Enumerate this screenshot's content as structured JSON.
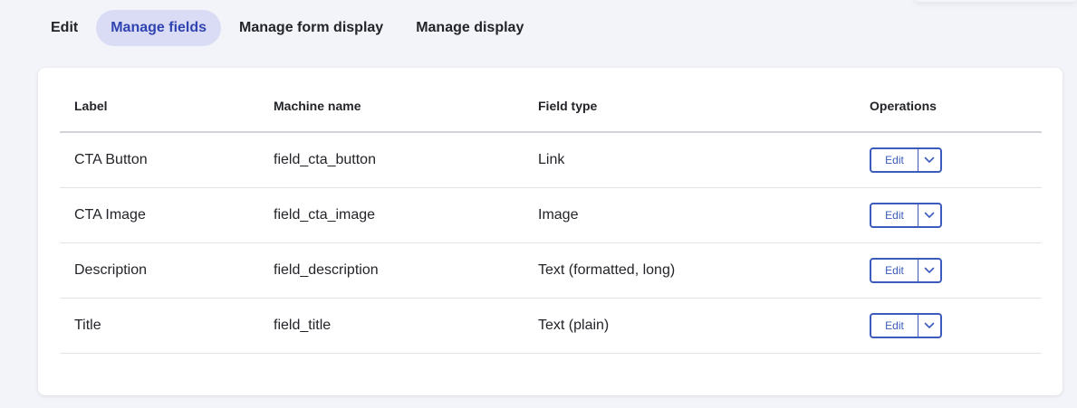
{
  "tabs": [
    {
      "label": "Edit",
      "active": false
    },
    {
      "label": "Manage fields",
      "active": true
    },
    {
      "label": "Manage form display",
      "active": false
    },
    {
      "label": "Manage display",
      "active": false
    }
  ],
  "table": {
    "headers": {
      "label": "Label",
      "machine_name": "Machine name",
      "field_type": "Field type",
      "operations": "Operations"
    },
    "rows": [
      {
        "label": "CTA Button",
        "machine_name": "field_cta_button",
        "field_type": "Link",
        "edit": "Edit"
      },
      {
        "label": "CTA Image",
        "machine_name": "field_cta_image",
        "field_type": "Image",
        "edit": "Edit"
      },
      {
        "label": "Description",
        "machine_name": "field_description",
        "field_type": "Text (formatted, long)",
        "edit": "Edit"
      },
      {
        "label": "Title",
        "machine_name": "field_title",
        "field_type": "Text (plain)",
        "edit": "Edit"
      }
    ]
  },
  "colors": {
    "accent": "#3b5bbd",
    "active_tab_bg": "#dadcf6",
    "active_tab_text": "#2f44b0",
    "page_bg": "#f3f4f9"
  },
  "icons": {
    "operations_toggle": "chevron-down-icon"
  }
}
